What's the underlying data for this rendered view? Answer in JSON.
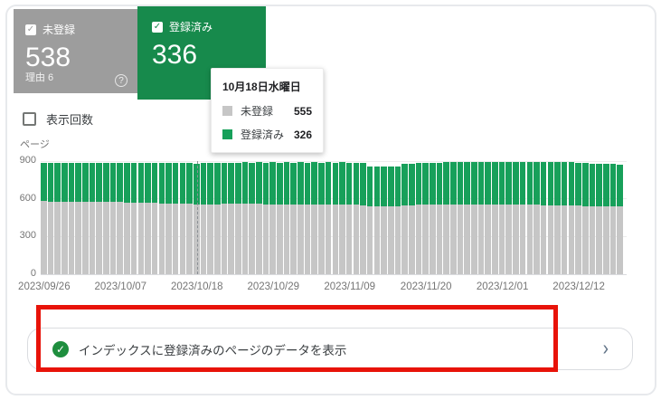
{
  "cards": {
    "unregistered": {
      "label": "未登録",
      "value": "538",
      "sublabel": "理由 6",
      "check": "✓",
      "help": "?",
      "color": "#9d9d9d"
    },
    "registered": {
      "label": "登録済み",
      "value": "336",
      "check": "✓",
      "color": "#178a4c"
    }
  },
  "impressions_toggle": {
    "label": "表示回数",
    "checked": false
  },
  "tooltip": {
    "title": "10月18日水曜日",
    "rows": [
      {
        "label": "未登録",
        "value": "555",
        "swatch": "#c6c6c6"
      },
      {
        "label": "登録済み",
        "value": "326",
        "swatch": "#17a05a"
      }
    ]
  },
  "chart_data": {
    "type": "bar",
    "stacked": true,
    "ylabel": "ページ",
    "ylim": [
      0,
      900
    ],
    "yticks": [
      0,
      300,
      600,
      900
    ],
    "x_tick_labels": [
      "2023/09/26",
      "2023/10/07",
      "2023/10/18",
      "2023/10/29",
      "2023/11/09",
      "2023/11/20",
      "2023/12/01",
      "2023/12/12"
    ],
    "x_tick_indices": [
      0,
      11,
      22,
      33,
      44,
      55,
      66,
      77
    ],
    "hover_index": 22,
    "series": [
      {
        "name": "未登録",
        "color": "#c6c6c6",
        "values": [
          580,
          579,
          578,
          578,
          577,
          576,
          576,
          575,
          575,
          574,
          574,
          573,
          572,
          570,
          569,
          568,
          566,
          565,
          564,
          562,
          561,
          560,
          555,
          557,
          558,
          558,
          559,
          559,
          560,
          560,
          559,
          559,
          558,
          558,
          557,
          557,
          556,
          556,
          555,
          555,
          554,
          554,
          553,
          553,
          552,
          551,
          550,
          540,
          538,
          537,
          538,
          539,
          548,
          550,
          551,
          553,
          554,
          554,
          555,
          555,
          556,
          556,
          555,
          555,
          554,
          554,
          553,
          553,
          552,
          552,
          551,
          551,
          550,
          550,
          549,
          549,
          548,
          545,
          543,
          542,
          540,
          539,
          538,
          538
        ]
      },
      {
        "name": "登録済み",
        "color": "#17a05a",
        "values": [
          308,
          309,
          310,
          310,
          311,
          311,
          312,
          312,
          313,
          313,
          314,
          314,
          315,
          316,
          317,
          318,
          319,
          320,
          321,
          322,
          324,
          325,
          326,
          327,
          327,
          328,
          328,
          329,
          329,
          330,
          330,
          331,
          331,
          332,
          332,
          333,
          333,
          334,
          334,
          335,
          335,
          336,
          336,
          337,
          337,
          337,
          338,
          320,
          318,
          317,
          318,
          320,
          330,
          332,
          333,
          334,
          334,
          335,
          335,
          336,
          336,
          337,
          337,
          338,
          338,
          339,
          339,
          340,
          340,
          341,
          341,
          342,
          342,
          343,
          343,
          344,
          344,
          342,
          341,
          340,
          339,
          338,
          337,
          336
        ]
      }
    ]
  },
  "bottom_row": {
    "label": "インデックスに登録済みのページのデータを表示",
    "chevron": "›",
    "check_color": "#1e8e3e"
  },
  "annotation": {
    "color": "#e81309"
  }
}
